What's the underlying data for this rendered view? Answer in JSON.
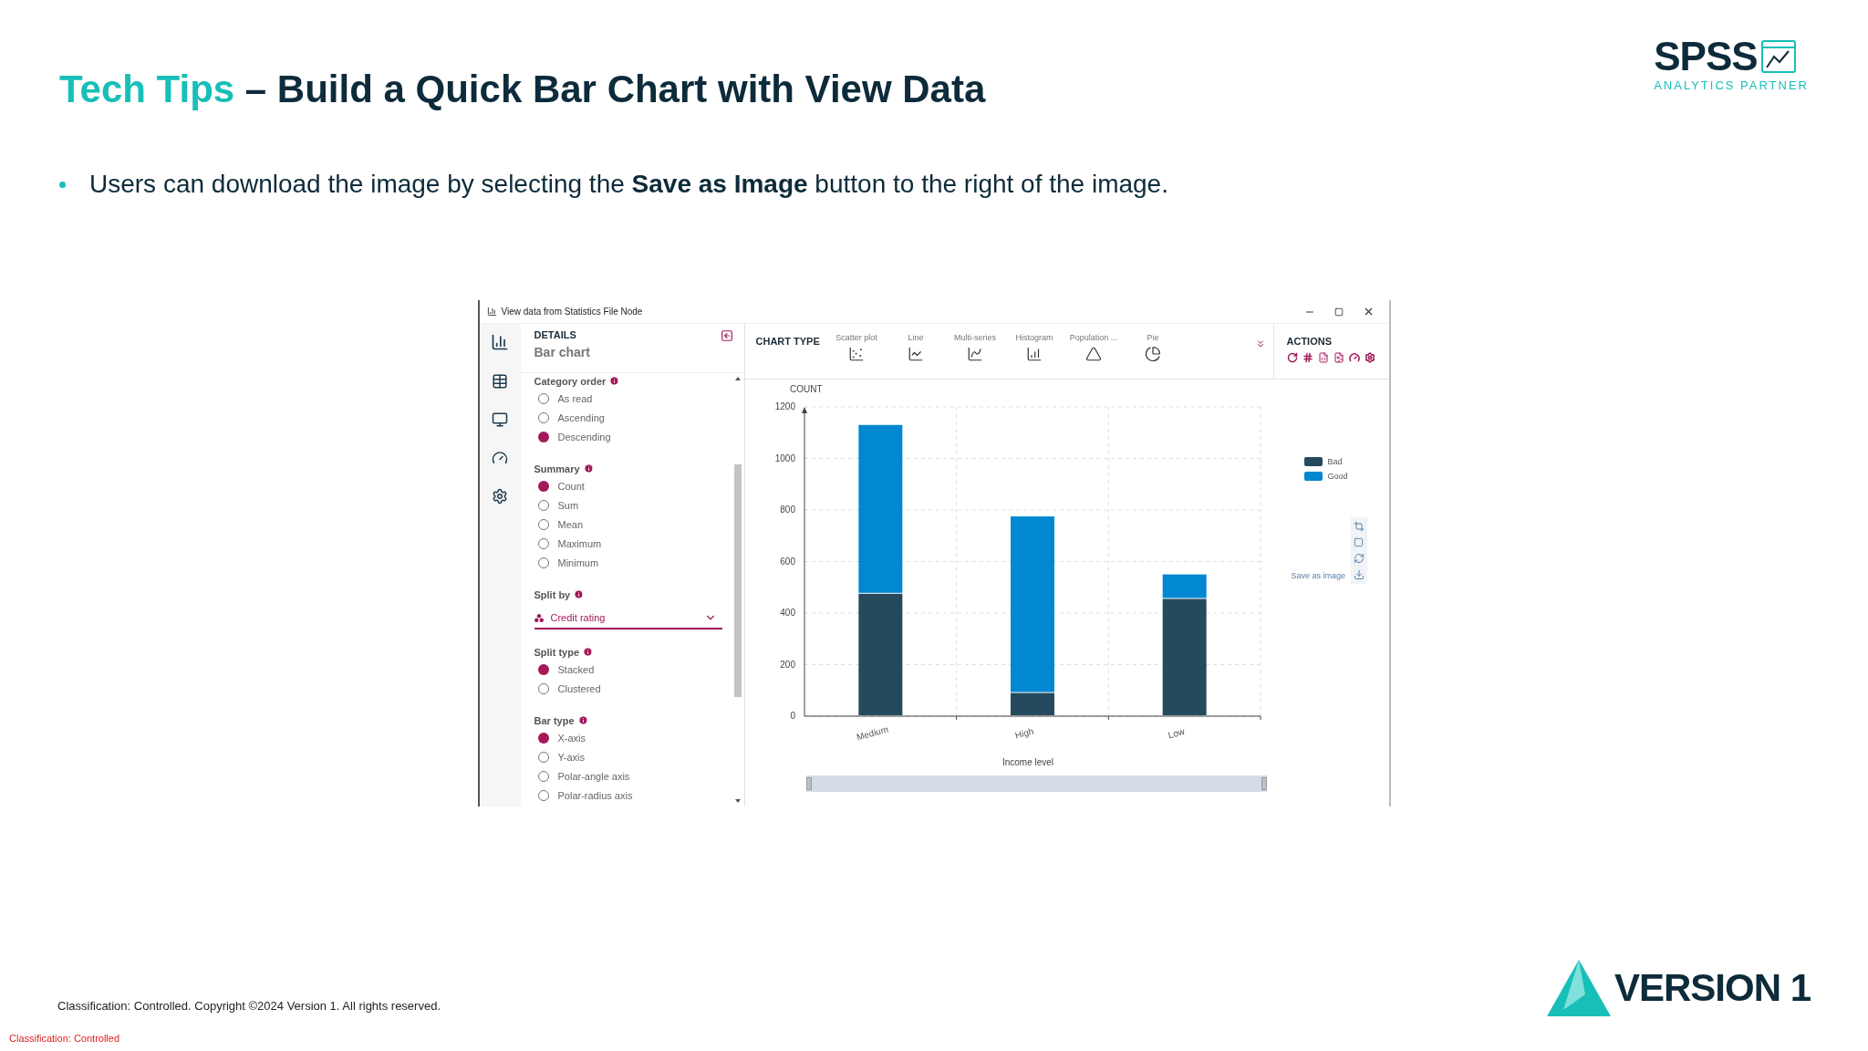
{
  "slide": {
    "title": {
      "accent": "Tech Tips",
      "text": "– Build a Quick Bar Chart with View Data"
    },
    "logo": {
      "name": "SPSS",
      "tagline": "ANALYTICS PARTNER"
    },
    "bullets": [
      "Users can download the image by selecting the **Save as Image** button to the right of the image."
    ]
  },
  "window": {
    "title": "View data from Statistics File Node",
    "details": {
      "heading": "DETAILS",
      "subtitle": "Bar chart",
      "sections": [
        {
          "kind": "radio",
          "title": "Category order",
          "options": [
            {
              "label": "As read",
              "selected": false
            },
            {
              "label": "Ascending",
              "selected": false
            },
            {
              "label": "Descending",
              "selected": true
            }
          ]
        },
        {
          "kind": "radio",
          "title": "Summary",
          "options": [
            {
              "label": "Count",
              "selected": true
            },
            {
              "label": "Sum",
              "selected": false
            },
            {
              "label": "Mean",
              "selected": false
            },
            {
              "label": "Maximum",
              "selected": false
            },
            {
              "label": "Minimum",
              "selected": false
            }
          ]
        },
        {
          "kind": "dropdown",
          "title": "Split by",
          "value": "Credit rating"
        },
        {
          "kind": "radio",
          "title": "Split type",
          "options": [
            {
              "label": "Stacked",
              "selected": true
            },
            {
              "label": "Clustered",
              "selected": false
            }
          ]
        },
        {
          "kind": "radio",
          "title": "Bar type",
          "options": [
            {
              "label": "X-axis",
              "selected": true
            },
            {
              "label": "Y-axis",
              "selected": false
            },
            {
              "label": "Polar-angle axis",
              "selected": false
            },
            {
              "label": "Polar-radius axis",
              "selected": false
            }
          ]
        }
      ]
    },
    "chart_type": {
      "heading": "CHART TYPE",
      "items": [
        {
          "label": "Scatter plot",
          "kind": "scatter"
        },
        {
          "label": "Line",
          "kind": "line"
        },
        {
          "label": "Multi-series",
          "kind": "multi"
        },
        {
          "label": "Histogram",
          "kind": "histogram"
        },
        {
          "label": "Population ...",
          "kind": "pyramid"
        },
        {
          "label": "Pie",
          "kind": "pie"
        }
      ]
    },
    "actions": {
      "heading": "ACTIONS"
    },
    "chart": {
      "chart_data": {
        "type": "bar",
        "stacked": true,
        "ylabel": "COUNT",
        "xlabel": "Income level",
        "categories": [
          "Medium",
          "High",
          "Low"
        ],
        "series": [
          {
            "name": "Bad",
            "color": "#254a5e",
            "values": [
              475,
              90,
              455
            ]
          },
          {
            "name": "Good",
            "color": "#0288d1",
            "values": [
              655,
              685,
              95
            ]
          }
        ],
        "ylim": [
          0,
          1200
        ],
        "yticks": [
          0,
          200,
          400,
          600,
          800,
          1000,
          1200
        ],
        "grid": true
      },
      "range_slider": {
        "level": 1
      },
      "save_label": "Save as image"
    }
  },
  "footer": {
    "copyright": "Classification: Controlled. Copyright ©2024 Version 1. All rights reserved.",
    "classification": "Classification: Controlled",
    "brand": "VERSION 1"
  }
}
